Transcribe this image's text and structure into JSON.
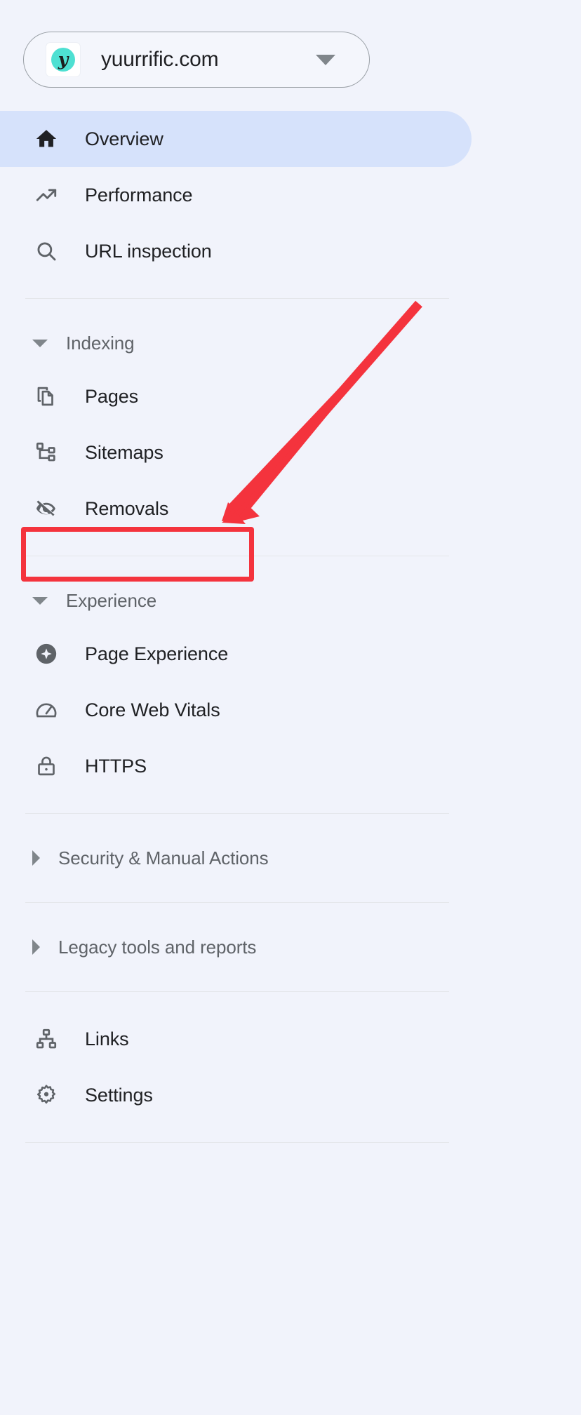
{
  "app": {
    "background_color": "#f1f3fb",
    "accent_color": "#d6e2fb",
    "annotation_color": "#f4333d"
  },
  "property_selector": {
    "name": "property-selector",
    "site": "yuurrific.com",
    "favicon_letter": "y",
    "favicon_color": "#4ee0d2",
    "dropdown_icon": "chevron-down-icon"
  },
  "nav": {
    "top_items": [
      {
        "label": "Overview",
        "icon": "home-icon",
        "active": true
      },
      {
        "label": "Performance",
        "icon": "trending-up-icon",
        "active": false
      },
      {
        "label": "URL inspection",
        "icon": "search-icon",
        "active": false
      }
    ],
    "indexing": {
      "label": "Indexing",
      "expanded": true,
      "caret_icon": "caret-down-icon",
      "items": [
        {
          "label": "Pages",
          "icon": "pages-copy-icon",
          "active": false
        },
        {
          "label": "Sitemaps",
          "icon": "account-tree-icon",
          "active": false,
          "highlighted": true
        },
        {
          "label": "Removals",
          "icon": "eye-off-icon",
          "active": false
        }
      ]
    },
    "experience": {
      "label": "Experience",
      "expanded": true,
      "caret_icon": "caret-down-icon",
      "items": [
        {
          "label": "Page Experience",
          "icon": "page-experience-star-icon",
          "active": false
        },
        {
          "label": "Core Web Vitals",
          "icon": "speedometer-icon",
          "active": false
        },
        {
          "label": "HTTPS",
          "icon": "lock-icon",
          "active": false
        }
      ]
    },
    "collapsed_sections": [
      {
        "label": "Security & Manual Actions",
        "expanded": false,
        "caret_icon": "caret-right-icon"
      },
      {
        "label": "Legacy tools and reports",
        "expanded": false,
        "caret_icon": "caret-right-icon"
      }
    ],
    "bottom_items": [
      {
        "label": "Links",
        "icon": "schema-icon",
        "active": false
      },
      {
        "label": "Settings",
        "icon": "gear-icon",
        "active": false
      }
    ]
  },
  "annotations": {
    "arrow": {
      "name": "pointer-arrow",
      "points_to": "Sitemaps",
      "color": "#f4333d"
    },
    "box": {
      "name": "highlight-box",
      "targets": "Sitemaps",
      "color": "#f4333d"
    }
  }
}
